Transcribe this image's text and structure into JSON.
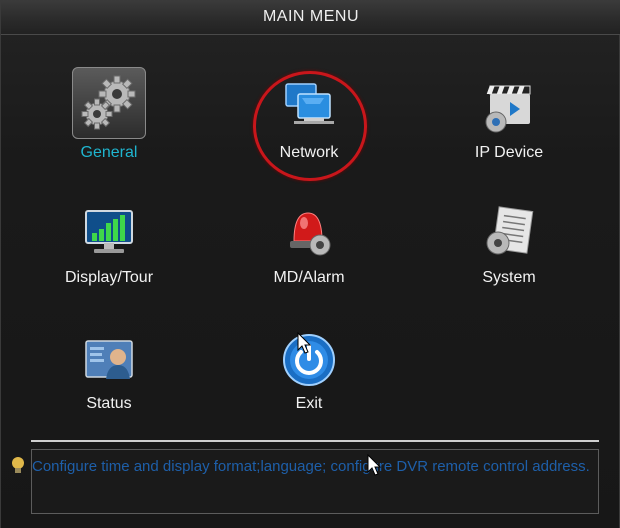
{
  "window": {
    "title": "MAIN MENU"
  },
  "menu": {
    "items": [
      {
        "label": "General",
        "icon": "gears-icon",
        "selected": true
      },
      {
        "label": "Network",
        "icon": "network-monitors-icon",
        "selected": false
      },
      {
        "label": "IP Device",
        "icon": "clapper-gear-icon",
        "selected": false
      },
      {
        "label": "Display/Tour",
        "icon": "monitor-bars-icon",
        "selected": false
      },
      {
        "label": "MD/Alarm",
        "icon": "siren-gear-icon",
        "selected": false
      },
      {
        "label": "System",
        "icon": "document-gear-icon",
        "selected": false
      },
      {
        "label": "Status",
        "icon": "user-status-icon",
        "selected": false
      },
      {
        "label": "Exit",
        "icon": "power-icon",
        "selected": false
      }
    ]
  },
  "hint": {
    "text": "Configure time and display format;language; configure DVR remote control address."
  },
  "colors": {
    "selected_label": "#1fb5cf",
    "highlight_ring": "#c9161b",
    "hint_text": "#1e5fa9"
  }
}
